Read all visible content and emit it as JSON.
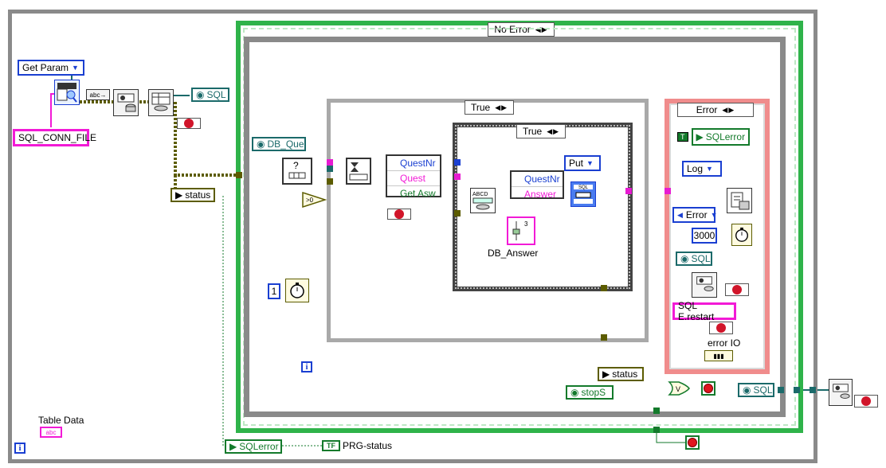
{
  "window": {
    "kind": "LabVIEW block diagram",
    "colors": {
      "error_cluster": "#5c5c00",
      "string": "#f21ad6",
      "refnum": "#1b6a6a",
      "boolean": "#137a2b",
      "numeric": "#1a3fd1",
      "structure": "#8a8a8a"
    }
  },
  "left": {
    "get_param_enum": "Get Param",
    "conn_file_const": "SQL_CONN_FILE",
    "sql_local": "SQL",
    "status_local": "status",
    "info_label": "i",
    "table_data_label": "Table Data",
    "table_data_terminal": "abc"
  },
  "case_no_error": {
    "selector": "No Error"
  },
  "inner_left": {
    "db_que_local": "DB_Que",
    "wait_const": "1",
    "info_label": "i"
  },
  "case_true_outer": {
    "selector": "True"
  },
  "case_true_inner": {
    "selector": "True"
  },
  "unbundle": {
    "rows": [
      "QuestNr",
      "Quest",
      "Get Asw"
    ]
  },
  "bundle": {
    "rows": [
      "QuestNr",
      "Answer"
    ]
  },
  "put_enum": "Put",
  "db_answer": {
    "label": "DB_Answer",
    "index": "3"
  },
  "error_case": {
    "selector": "Error",
    "sqlerror_local": "SQLerror",
    "log_enum": "Log",
    "error_enum": "Error",
    "wait_const": "3000",
    "sql_local": "SQL",
    "restart_const": "SQL E.restart",
    "error_io_label": "error IO"
  },
  "bottom": {
    "status_local": "status",
    "stop_local": "stopS",
    "or_label": "V",
    "sql_local": "SQL",
    "sqlerror_local": "SQLerror",
    "prg_status_terminal": "TF",
    "prg_status_label": "PRG-status"
  }
}
